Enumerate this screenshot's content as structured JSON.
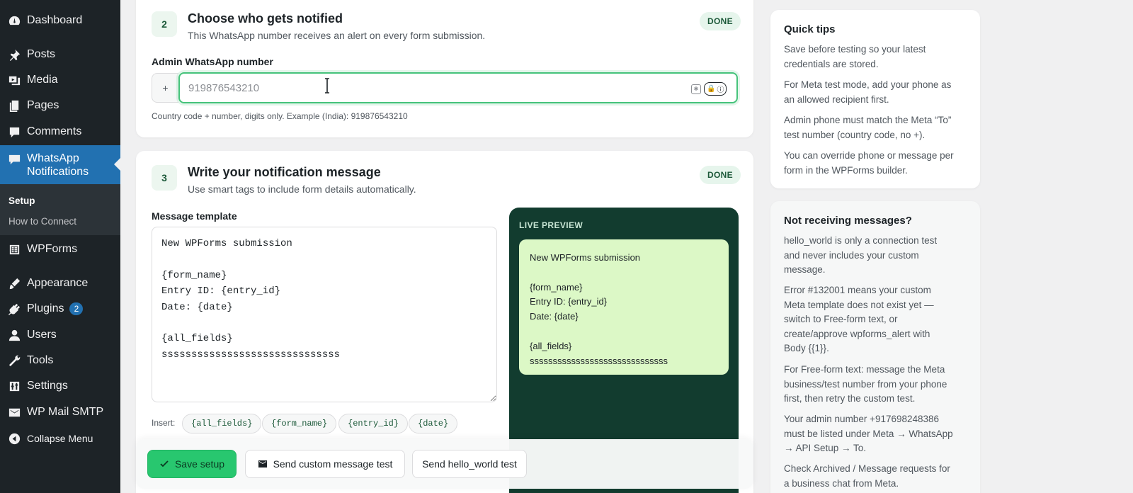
{
  "sidebar": {
    "items": [
      {
        "label": "Dashboard",
        "icon": "dashboard-icon"
      },
      {
        "label": "Posts",
        "icon": "pin-icon"
      },
      {
        "label": "Media",
        "icon": "media-icon"
      },
      {
        "label": "Pages",
        "icon": "pages-icon"
      },
      {
        "label": "Comments",
        "icon": "comments-icon"
      },
      {
        "label": "WhatsApp Notifications",
        "icon": "whatsapp-icon"
      },
      {
        "label": "WPForms",
        "icon": "wpforms-icon"
      },
      {
        "label": "Appearance",
        "icon": "appearance-icon"
      },
      {
        "label": "Plugins",
        "icon": "plugins-icon",
        "badge": "2"
      },
      {
        "label": "Users",
        "icon": "users-icon"
      },
      {
        "label": "Tools",
        "icon": "tools-icon"
      },
      {
        "label": "Settings",
        "icon": "settings-icon"
      },
      {
        "label": "WP Mail SMTP",
        "icon": "mail-icon"
      },
      {
        "label": "Collapse Menu",
        "icon": "collapse-icon"
      }
    ],
    "submenu": [
      "Setup",
      "How to Connect"
    ]
  },
  "step2": {
    "number": "2",
    "title": "Choose who gets notified",
    "subtitle": "This WhatsApp number receives an alert on every form submission.",
    "status": "DONE",
    "field_label": "Admin WhatsApp number",
    "prefix": "+",
    "placeholder": "919876543210",
    "hint": "Country code + number, digits only. Example (India): 919876543210"
  },
  "step3": {
    "number": "3",
    "title": "Write your notification message",
    "subtitle": "Use smart tags to include form details automatically.",
    "status": "DONE",
    "field_label": "Message template",
    "template": "New WPForms submission\n\n{form_name}\nEntry ID: {entry_id}\nDate: {date}\n\n{all_fields}\nssssssssssssssssssssssssssssss",
    "insert_label": "Insert:",
    "tags": [
      "{all_fields}",
      "{form_name}",
      "{entry_id}",
      "{date}"
    ],
    "preview_label": "LIVE PREVIEW",
    "preview_text": "New WPForms submission\n\n{form_name}\nEntry ID: {entry_id}\nDate: {date}\n\n{all_fields}\nssssssssssssssssssssssssssssss"
  },
  "actions": {
    "save": "Save setup",
    "custom_test": "Send custom message test",
    "hello_test": "Send hello_world test"
  },
  "tips": {
    "title": "Quick tips",
    "items": [
      "Save before testing so your latest credentials are stored.",
      "For Meta test mode, add your phone as an allowed recipient first.",
      "Admin phone must match the Meta “To” test number (country code, no +).",
      "You can override phone or message per form in the WPForms builder."
    ]
  },
  "troubleshoot": {
    "title": "Not receiving messages?",
    "items": [
      "hello_world is only a connection test and never includes your custom message.",
      "Error #132001 means your custom Meta template does not exist yet — switch to Free-form text, or create/approve wpforms_alert with Body {{1}}.",
      "For Free-form text: message the Meta business/test number from your phone first, then retry the custom test.",
      "Your admin number +917698248386 must be listed under Meta → WhatsApp → API Setup → To.",
      "Check Archived / Message requests for a business chat from Meta."
    ]
  }
}
